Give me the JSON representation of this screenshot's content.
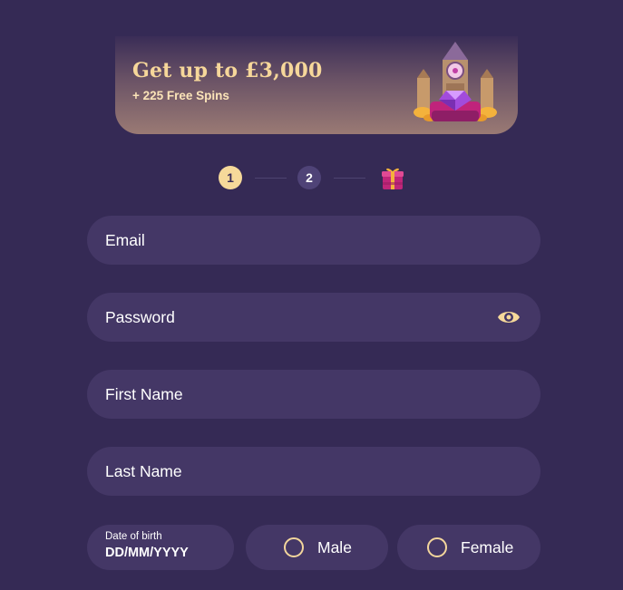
{
  "banner": {
    "title": "Get up to £3,000",
    "subtitle": "+ 225 Free Spins",
    "art_icon": "big-ben-jewel-icon"
  },
  "steps": {
    "items": [
      {
        "label": "1",
        "state": "active"
      },
      {
        "label": "2",
        "state": "inactive"
      }
    ],
    "final_icon": "gift-icon"
  },
  "form": {
    "email_placeholder": "Email",
    "password_placeholder": "Password",
    "password_toggle_icon": "eye-icon",
    "first_name_placeholder": "First Name",
    "last_name_placeholder": "Last Name",
    "dob_label": "Date of birth",
    "dob_placeholder": "DD/MM/YYYY",
    "gender_options": [
      "Male",
      "Female"
    ]
  },
  "colors": {
    "background": "#352a55",
    "field_bg": "#443766",
    "accent": "#f6d99a",
    "step_inactive": "#4f4377"
  }
}
